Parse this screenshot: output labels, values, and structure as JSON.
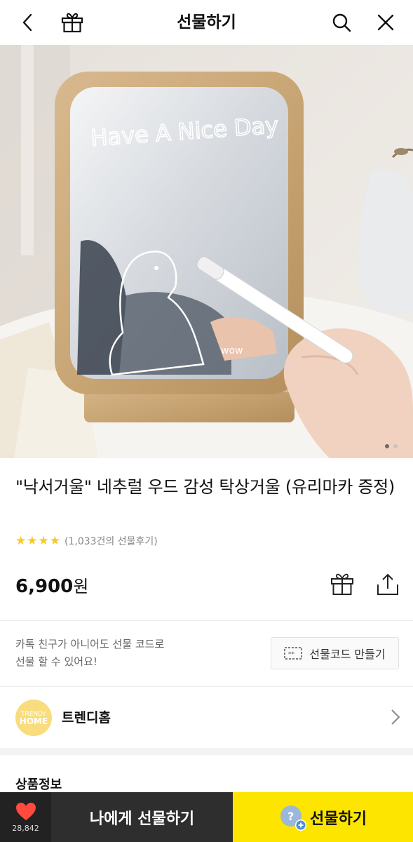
{
  "header": {
    "title": "선물하기",
    "icons": [
      "back-arrow-icon",
      "gift-icon",
      "search-icon",
      "close-icon"
    ]
  },
  "hero": {
    "mirror_text": "Have A Nice Day",
    "mirror_doodle": "wow",
    "slide_current": 1,
    "slide_total": 2
  },
  "product": {
    "title": "\"낙서거울\" 네추럴 우드 감성 탁상거울 (유리마카 증정)",
    "stars": 4,
    "review_text": "(1,033건의 선물후기)",
    "price": "6,900",
    "price_unit": "원"
  },
  "gift_code": {
    "line1": "카톡 친구가 아니어도 선물 코드로",
    "line2": "선물 할 수 있어요!",
    "button_label": "선물코드 만들기"
  },
  "shop": {
    "logo_line1": "TRENDY",
    "logo_line2": "HOME",
    "name": "트렌디홈"
  },
  "section": {
    "title": "상품정보"
  },
  "bottom_bar": {
    "like_count": "28,842",
    "self_gift_label": "나에게 선물하기",
    "gift_label": "선물하기"
  },
  "colors": {
    "accent_yellow": "#fee500",
    "star": "#f7c928",
    "heart": "#ff4a3d",
    "dark_button": "#2e2e2e"
  }
}
